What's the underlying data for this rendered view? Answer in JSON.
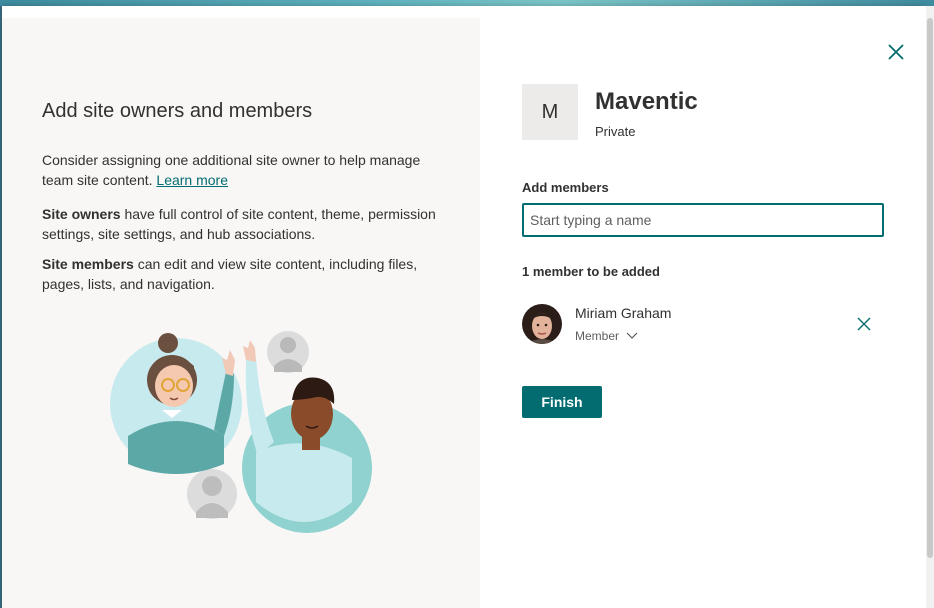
{
  "colors": {
    "accent": "#036c70",
    "left_panel_bg": "#f8f7f6",
    "site_tile_bg": "#edebe9",
    "text": "#323130"
  },
  "left_panel": {
    "title": "Add site owners and members",
    "intro": "Consider assigning one additional site owner to help manage team site content.",
    "learn_more": "Learn more",
    "owners_term": "Site owners",
    "owners_desc": "have full control of site content, theme, permission settings, site settings, and hub associations.",
    "members_term": "Site members",
    "members_desc": "can edit and view site content, including files, pages, lists, and navigation.",
    "illustration": "team-collaboration-illustration"
  },
  "site": {
    "initial": "M",
    "name": "Maventic",
    "privacy": "Private"
  },
  "add_members": {
    "label": "Add members",
    "placeholder": "Start typing a name",
    "value": ""
  },
  "pending": {
    "count_label": "1 member to be added",
    "members": [
      {
        "name": "Miriam Graham",
        "role": "Member"
      }
    ]
  },
  "icons": {
    "close": "close-icon",
    "remove": "remove-member-icon",
    "dropdown": "chevron-down-icon"
  },
  "actions": {
    "finish": "Finish"
  }
}
